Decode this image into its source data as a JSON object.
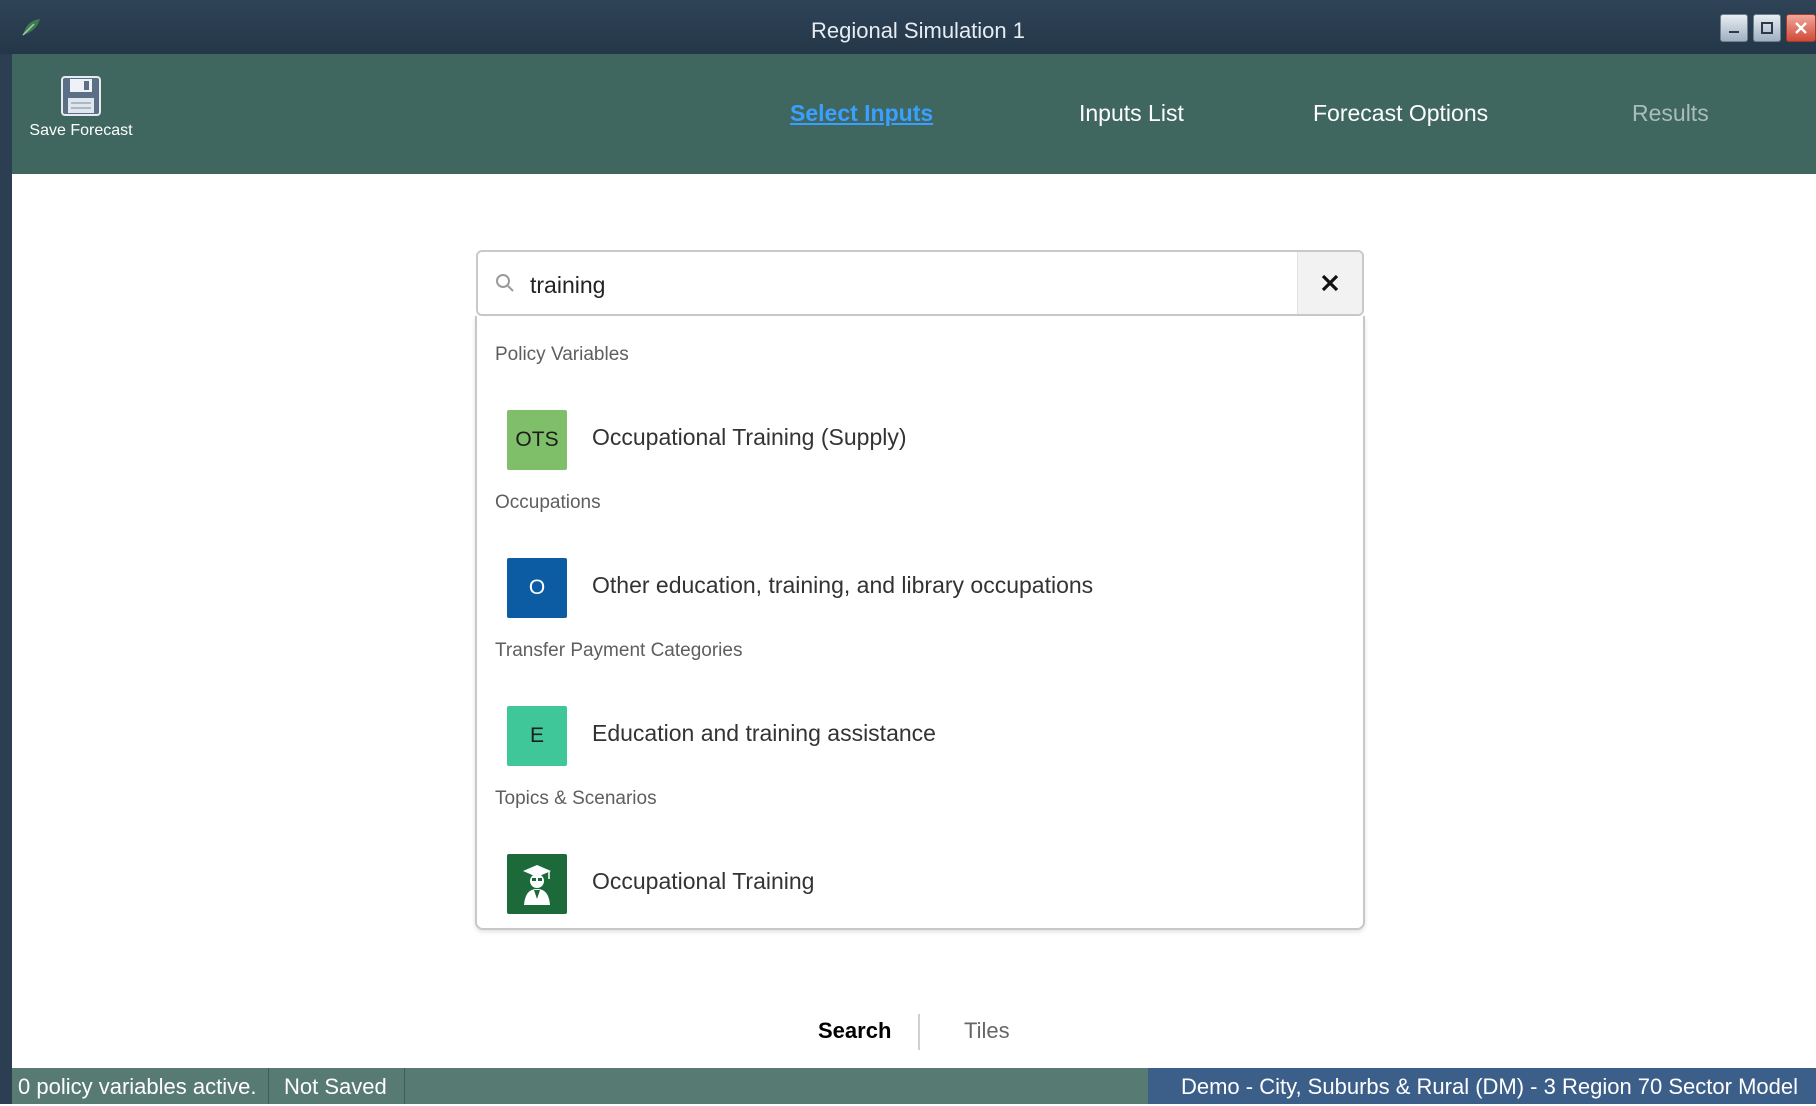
{
  "window": {
    "title": "Regional Simulation 1",
    "controls": [
      "minimize",
      "maximize",
      "close"
    ]
  },
  "toolbar": {
    "save_label": "Save Forecast",
    "nav": [
      {
        "label": "Select Inputs",
        "state": "active"
      },
      {
        "label": "Inputs List",
        "state": "normal"
      },
      {
        "label": "Forecast Options",
        "state": "normal"
      },
      {
        "label": "Results",
        "state": "disabled"
      }
    ]
  },
  "search": {
    "value": "training",
    "clear_icon": "close-icon",
    "groups": [
      {
        "label": "Policy Variables",
        "items": [
          {
            "badge": "OTS",
            "badge_color": "#7fbf6a",
            "label": "Occupational Training (Supply)"
          }
        ]
      },
      {
        "label": "Occupations",
        "items": [
          {
            "badge": "O",
            "badge_color": "#0c5ca3",
            "label": "Other education, training, and library occupations"
          }
        ]
      },
      {
        "label": "Transfer Payment Categories",
        "items": [
          {
            "badge": "E",
            "badge_color": "#3fc79a",
            "label": "Education and training assistance"
          }
        ]
      },
      {
        "label": "Topics & Scenarios",
        "items": [
          {
            "badge": "",
            "badge_icon": "graduate-icon",
            "badge_color": "#1c6a3a",
            "label": "Occupational Training"
          }
        ]
      }
    ]
  },
  "view_switch": {
    "search_label": "Search",
    "tiles_label": "Tiles",
    "active": "Search"
  },
  "status": {
    "policy": "0 policy variables active.",
    "saved": "Not Saved",
    "model": "Demo - City, Suburbs & Rural (DM) -  3 Region 70 Sector Model"
  },
  "colors": {
    "titlebar": "#243748",
    "toolbar": "#40675f",
    "active_nav": "#3aa0ff",
    "statusbar": "#577a73",
    "status_model_bg": "#3c5f8a"
  }
}
